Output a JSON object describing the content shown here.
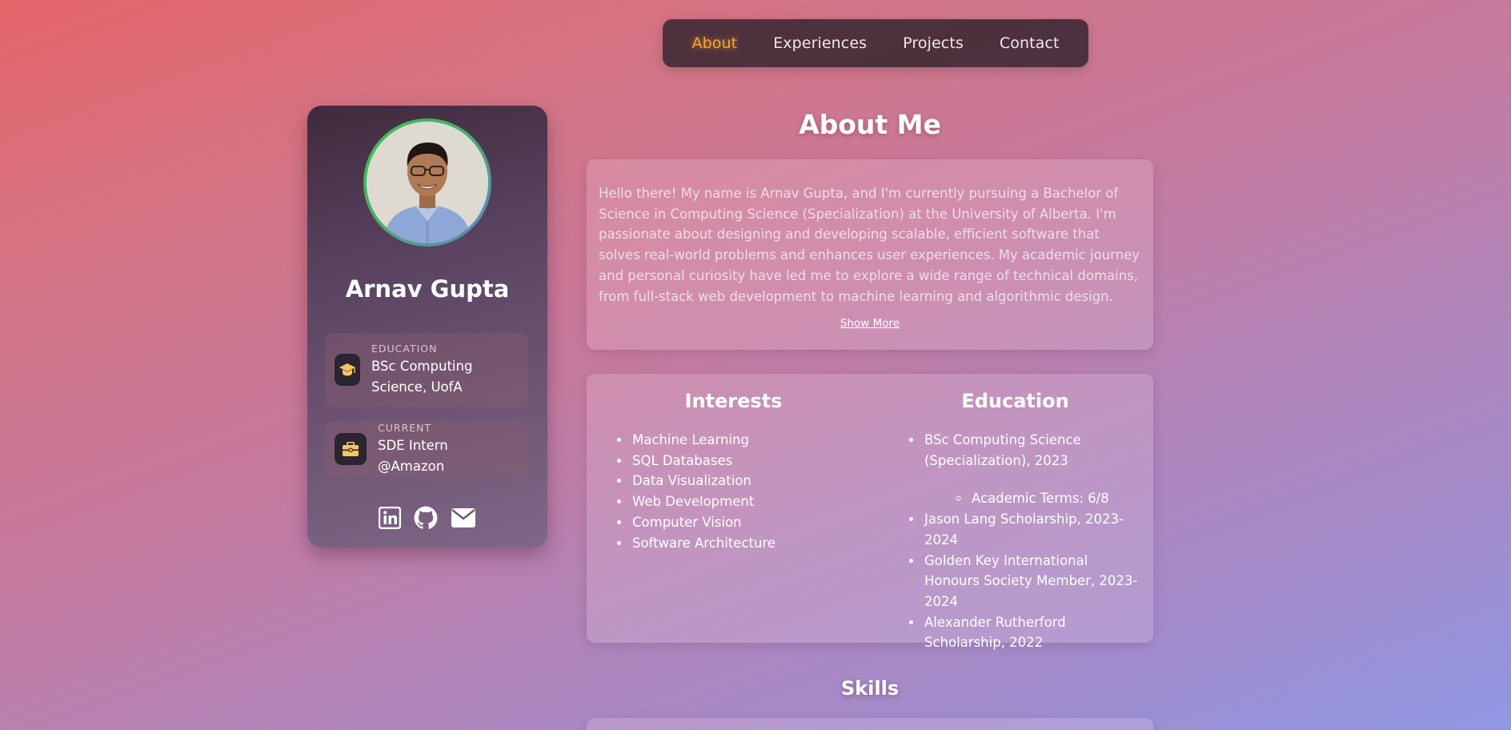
{
  "nav": {
    "items": [
      {
        "label": "About",
        "active": true
      },
      {
        "label": "Experiences",
        "active": false
      },
      {
        "label": "Projects",
        "active": false
      },
      {
        "label": "Contact",
        "active": false
      }
    ]
  },
  "profile": {
    "name": "Arnav Gupta",
    "education": {
      "label": "EDUCATION",
      "value": "BSc Computing Science, UofA",
      "icon": "graduation-cap-icon"
    },
    "current": {
      "label": "CURRENT",
      "value": "SDE Intern @Amazon",
      "icon": "briefcase-icon"
    },
    "socials": [
      "linkedin-icon",
      "github-icon",
      "mail-icon"
    ]
  },
  "about": {
    "title": "About Me",
    "paragraph": "Hello there! My name is Arnav Gupta, and I'm currently pursuing a Bachelor of Science in Computing Science (Specialization) at the University of Alberta. I'm passionate about designing and developing scalable, efficient software that solves real-world problems and enhances user experiences. My academic journey and personal curiosity have led me to explore a wide range of technical domains, from full-stack web development to machine learning and algorithmic design.",
    "show_more": "Show More"
  },
  "interests": {
    "title": "Interests",
    "items": [
      "Machine Learning",
      "SQL Databases",
      "Data Visualization",
      "Web Development",
      "Computer Vision",
      "Software Architecture"
    ]
  },
  "education": {
    "title": "Education",
    "item1": "BSc Computing Science (Specialization), 2023",
    "item1_sub": "Academic Terms: 6/8",
    "item2": "Jason Lang Scholarship, 2023-2024",
    "item3": "Golden Key International Honours Society Member, 2023-2024",
    "item4": "Alexander Rutherford Scholarship, 2022"
  },
  "skills": {
    "title": "Skills"
  },
  "colors": {
    "nav_active": "#f7a531",
    "avatar_ring_start": "#3fbf4a",
    "avatar_ring_end": "#5f86c6",
    "info_icon_color": "#f6c561"
  }
}
